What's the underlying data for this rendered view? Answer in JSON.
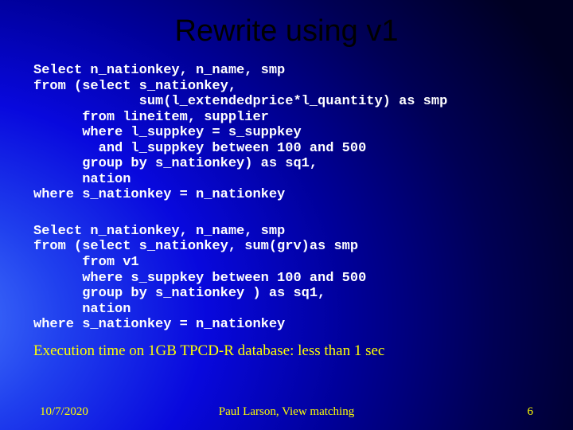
{
  "title": "Rewrite using v1",
  "code1": "Select n_nationkey, n_name, smp\nfrom (select s_nationkey,\n             sum(l_extendedprice*l_quantity) as smp\n      from lineitem, supplier\n      where l_suppkey = s_suppkey\n        and l_suppkey between 100 and 500\n      group by s_nationkey) as sq1,\n      nation\nwhere s_nationkey = n_nationkey",
  "code2": "Select n_nationkey, n_name, smp\nfrom (select s_nationkey, sum(grv)as smp\n      from v1\n      where s_suppkey between 100 and 500\n      group by s_nationkey ) as sq1,\n      nation\nwhere s_nationkey = n_nationkey",
  "exec_note": "Execution time on 1GB TPCD-R database: less than 1 sec",
  "footer": {
    "date": "10/7/2020",
    "author": "Paul Larson, View matching",
    "page": "6"
  }
}
